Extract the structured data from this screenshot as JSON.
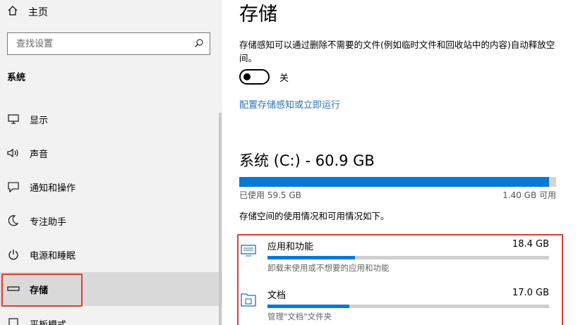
{
  "sidebar": {
    "home_label": "主页",
    "search_placeholder": "查找设置",
    "section_label": "系统",
    "items": [
      {
        "label": "显示",
        "icon": "display-icon"
      },
      {
        "label": "声音",
        "icon": "speaker-icon"
      },
      {
        "label": "通知和操作",
        "icon": "notification-icon"
      },
      {
        "label": "专注助手",
        "icon": "moon-icon"
      },
      {
        "label": "电源和睡眠",
        "icon": "power-icon"
      },
      {
        "label": "存储",
        "icon": "storage-icon",
        "active": true
      },
      {
        "label": "平板模式",
        "icon": "tablet-icon"
      }
    ]
  },
  "main": {
    "title": "存储",
    "storage_sense_desc": "存储感知可以通过删除不需要的文件(例如临时文件和回收站中的内容)自动释放空间。",
    "toggle_state": "关",
    "configure_link": "配置存储感知或立即运行",
    "drive": {
      "title": "系统 (C:) - 60.9 GB",
      "used_label": "已使用 59.5 GB",
      "free_label": "1.40 GB 可用",
      "used_fraction": 0.977
    },
    "usage_note": "存储空间的使用情况和可用情况如下。",
    "categories": [
      {
        "name": "应用和功能",
        "size": "18.4 GB",
        "sub": "卸载未使用或不想要的应用和功能",
        "fraction": 0.31,
        "icon": "apps-icon"
      },
      {
        "name": "文档",
        "size": "17.0 GB",
        "sub": "管理\"文档\"文件夹",
        "fraction": 0.29,
        "icon": "documents-icon"
      }
    ]
  },
  "colors": {
    "accent": "#0a78d7",
    "highlight": "#e23b32",
    "link": "#2a75b8"
  }
}
